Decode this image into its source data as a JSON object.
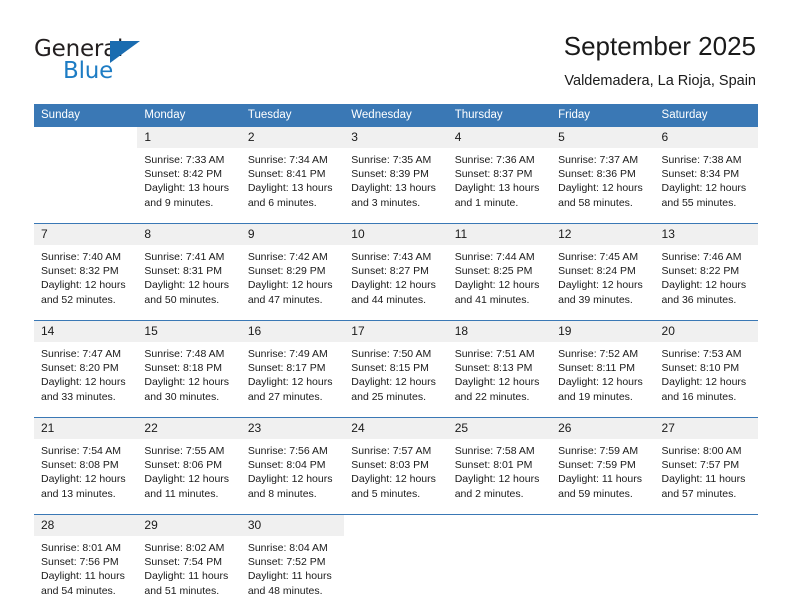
{
  "brand": {
    "name_top": "General",
    "name_bottom": "Blue",
    "color_dark": "#231f20",
    "color_blue": "#1d7cc4"
  },
  "header": {
    "title": "September 2025",
    "subtitle": "Valdemadera, La Rioja, Spain"
  },
  "theme": {
    "header_blue": "#3a78b5",
    "daynum_bg": "#f0f0f0",
    "text": "#1a1a1a"
  },
  "calendar": {
    "weekday_headers": [
      "Sunday",
      "Monday",
      "Tuesday",
      "Wednesday",
      "Thursday",
      "Friday",
      "Saturday"
    ],
    "weeks": [
      [
        {
          "day": "",
          "lines": [
            "",
            "",
            "",
            ""
          ]
        },
        {
          "day": "1",
          "lines": [
            "Sunrise: 7:33 AM",
            "Sunset: 8:42 PM",
            "Daylight: 13 hours",
            "and 9 minutes."
          ]
        },
        {
          "day": "2",
          "lines": [
            "Sunrise: 7:34 AM",
            "Sunset: 8:41 PM",
            "Daylight: 13 hours",
            "and 6 minutes."
          ]
        },
        {
          "day": "3",
          "lines": [
            "Sunrise: 7:35 AM",
            "Sunset: 8:39 PM",
            "Daylight: 13 hours",
            "and 3 minutes."
          ]
        },
        {
          "day": "4",
          "lines": [
            "Sunrise: 7:36 AM",
            "Sunset: 8:37 PM",
            "Daylight: 13 hours",
            "and 1 minute."
          ]
        },
        {
          "day": "5",
          "lines": [
            "Sunrise: 7:37 AM",
            "Sunset: 8:36 PM",
            "Daylight: 12 hours",
            "and 58 minutes."
          ]
        },
        {
          "day": "6",
          "lines": [
            "Sunrise: 7:38 AM",
            "Sunset: 8:34 PM",
            "Daylight: 12 hours",
            "and 55 minutes."
          ]
        }
      ],
      [
        {
          "day": "7",
          "lines": [
            "Sunrise: 7:40 AM",
            "Sunset: 8:32 PM",
            "Daylight: 12 hours",
            "and 52 minutes."
          ]
        },
        {
          "day": "8",
          "lines": [
            "Sunrise: 7:41 AM",
            "Sunset: 8:31 PM",
            "Daylight: 12 hours",
            "and 50 minutes."
          ]
        },
        {
          "day": "9",
          "lines": [
            "Sunrise: 7:42 AM",
            "Sunset: 8:29 PM",
            "Daylight: 12 hours",
            "and 47 minutes."
          ]
        },
        {
          "day": "10",
          "lines": [
            "Sunrise: 7:43 AM",
            "Sunset: 8:27 PM",
            "Daylight: 12 hours",
            "and 44 minutes."
          ]
        },
        {
          "day": "11",
          "lines": [
            "Sunrise: 7:44 AM",
            "Sunset: 8:25 PM",
            "Daylight: 12 hours",
            "and 41 minutes."
          ]
        },
        {
          "day": "12",
          "lines": [
            "Sunrise: 7:45 AM",
            "Sunset: 8:24 PM",
            "Daylight: 12 hours",
            "and 39 minutes."
          ]
        },
        {
          "day": "13",
          "lines": [
            "Sunrise: 7:46 AM",
            "Sunset: 8:22 PM",
            "Daylight: 12 hours",
            "and 36 minutes."
          ]
        }
      ],
      [
        {
          "day": "14",
          "lines": [
            "Sunrise: 7:47 AM",
            "Sunset: 8:20 PM",
            "Daylight: 12 hours",
            "and 33 minutes."
          ]
        },
        {
          "day": "15",
          "lines": [
            "Sunrise: 7:48 AM",
            "Sunset: 8:18 PM",
            "Daylight: 12 hours",
            "and 30 minutes."
          ]
        },
        {
          "day": "16",
          "lines": [
            "Sunrise: 7:49 AM",
            "Sunset: 8:17 PM",
            "Daylight: 12 hours",
            "and 27 minutes."
          ]
        },
        {
          "day": "17",
          "lines": [
            "Sunrise: 7:50 AM",
            "Sunset: 8:15 PM",
            "Daylight: 12 hours",
            "and 25 minutes."
          ]
        },
        {
          "day": "18",
          "lines": [
            "Sunrise: 7:51 AM",
            "Sunset: 8:13 PM",
            "Daylight: 12 hours",
            "and 22 minutes."
          ]
        },
        {
          "day": "19",
          "lines": [
            "Sunrise: 7:52 AM",
            "Sunset: 8:11 PM",
            "Daylight: 12 hours",
            "and 19 minutes."
          ]
        },
        {
          "day": "20",
          "lines": [
            "Sunrise: 7:53 AM",
            "Sunset: 8:10 PM",
            "Daylight: 12 hours",
            "and 16 minutes."
          ]
        }
      ],
      [
        {
          "day": "21",
          "lines": [
            "Sunrise: 7:54 AM",
            "Sunset: 8:08 PM",
            "Daylight: 12 hours",
            "and 13 minutes."
          ]
        },
        {
          "day": "22",
          "lines": [
            "Sunrise: 7:55 AM",
            "Sunset: 8:06 PM",
            "Daylight: 12 hours",
            "and 11 minutes."
          ]
        },
        {
          "day": "23",
          "lines": [
            "Sunrise: 7:56 AM",
            "Sunset: 8:04 PM",
            "Daylight: 12 hours",
            "and 8 minutes."
          ]
        },
        {
          "day": "24",
          "lines": [
            "Sunrise: 7:57 AM",
            "Sunset: 8:03 PM",
            "Daylight: 12 hours",
            "and 5 minutes."
          ]
        },
        {
          "day": "25",
          "lines": [
            "Sunrise: 7:58 AM",
            "Sunset: 8:01 PM",
            "Daylight: 12 hours",
            "and 2 minutes."
          ]
        },
        {
          "day": "26",
          "lines": [
            "Sunrise: 7:59 AM",
            "Sunset: 7:59 PM",
            "Daylight: 11 hours",
            "and 59 minutes."
          ]
        },
        {
          "day": "27",
          "lines": [
            "Sunrise: 8:00 AM",
            "Sunset: 7:57 PM",
            "Daylight: 11 hours",
            "and 57 minutes."
          ]
        }
      ],
      [
        {
          "day": "28",
          "lines": [
            "Sunrise: 8:01 AM",
            "Sunset: 7:56 PM",
            "Daylight: 11 hours",
            "and 54 minutes."
          ]
        },
        {
          "day": "29",
          "lines": [
            "Sunrise: 8:02 AM",
            "Sunset: 7:54 PM",
            "Daylight: 11 hours",
            "and 51 minutes."
          ]
        },
        {
          "day": "30",
          "lines": [
            "Sunrise: 8:04 AM",
            "Sunset: 7:52 PM",
            "Daylight: 11 hours",
            "and 48 minutes."
          ]
        },
        {
          "day": "",
          "lines": [
            "",
            "",
            "",
            ""
          ]
        },
        {
          "day": "",
          "lines": [
            "",
            "",
            "",
            ""
          ]
        },
        {
          "day": "",
          "lines": [
            "",
            "",
            "",
            ""
          ]
        },
        {
          "day": "",
          "lines": [
            "",
            "",
            "",
            ""
          ]
        }
      ]
    ]
  }
}
